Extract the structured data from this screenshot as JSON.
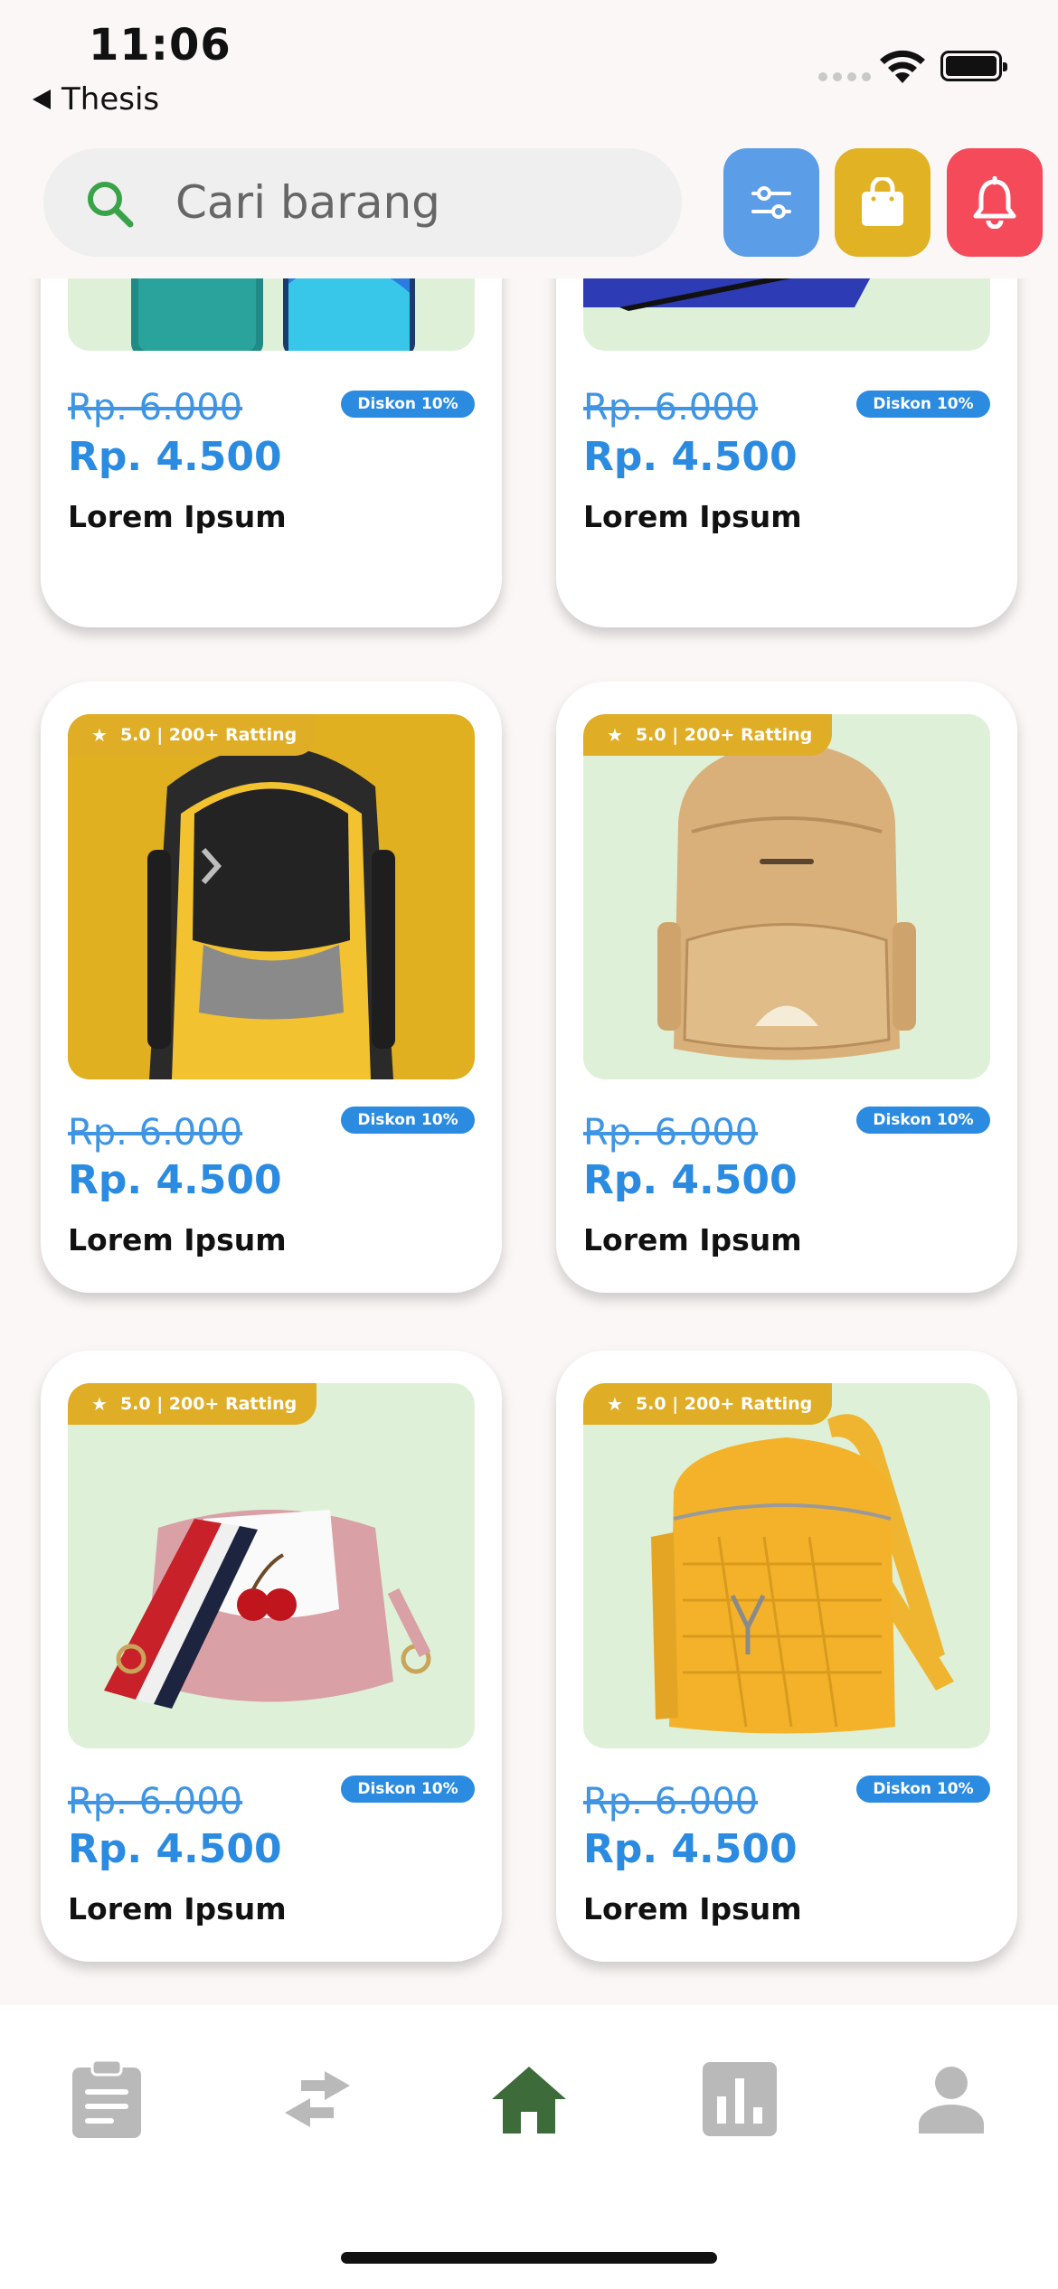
{
  "status_bar": {
    "time": "11:06",
    "back_label": "Thesis"
  },
  "search": {
    "placeholder": "Cari barang"
  },
  "header_buttons": [
    "filter-icon",
    "shopping-bag-icon",
    "bell-icon"
  ],
  "colors": {
    "accent_blue": "#2a8be0",
    "rating_gold": "#e0ad26",
    "filter_btn": "#5b9de6",
    "bag_btn": "#e0b224",
    "bell_btn": "#f44a5a",
    "nav_active": "#3e6b3a",
    "nav_inactive": "#b9b9b9"
  },
  "products": [
    {
      "rating": "",
      "old_price": "Rp. 6.000",
      "new_price": "Rp. 4.500",
      "discount": "Diskon 10%",
      "name": "Lorem Ipsum",
      "image": "phones"
    },
    {
      "rating": "",
      "old_price": "Rp. 6.000",
      "new_price": "Rp. 4.500",
      "discount": "Diskon 10%",
      "name": "Lorem Ipsum",
      "image": "tablet"
    },
    {
      "rating": "5.0 | 200+ Ratting",
      "old_price": "Rp. 6.000",
      "new_price": "Rp. 4.500",
      "discount": "Diskon 10%",
      "name": "Lorem Ipsum",
      "image": "yellow-backpack"
    },
    {
      "rating": "5.0 | 200+ Ratting",
      "old_price": "Rp. 6.000",
      "new_price": "Rp. 4.500",
      "discount": "Diskon 10%",
      "name": "Lorem Ipsum",
      "image": "beige-backpack"
    },
    {
      "rating": "5.0 | 200+ Ratting",
      "old_price": "Rp. 6.000",
      "new_price": "Rp. 4.500",
      "discount": "Diskon 10%",
      "name": "Lorem Ipsum",
      "image": "pink-shoulder-bag"
    },
    {
      "rating": "5.0 | 200+ Ratting",
      "old_price": "Rp. 6.000",
      "new_price": "Rp. 4.500",
      "discount": "Diskon 10%",
      "name": "Lorem Ipsum",
      "image": "mustard-backpack"
    }
  ],
  "bottom_nav": [
    {
      "icon": "clipboard-icon",
      "active": false
    },
    {
      "icon": "swap-arrows-icon",
      "active": false
    },
    {
      "icon": "home-icon",
      "active": true
    },
    {
      "icon": "bar-chart-icon",
      "active": false
    },
    {
      "icon": "person-icon",
      "active": false
    }
  ]
}
